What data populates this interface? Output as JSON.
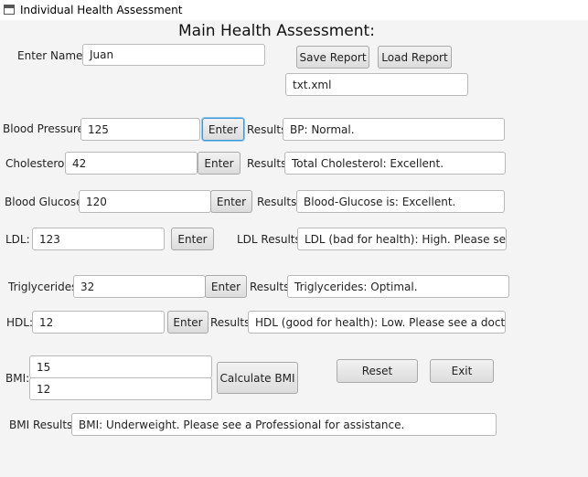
{
  "window": {
    "title": "Individual Health Assessment",
    "heading": "Main Health Assessment:"
  },
  "name": {
    "label": "Enter Name:",
    "value": "Juan"
  },
  "report": {
    "save_label": "Save Report",
    "load_label": "Load Report",
    "file_value": "txt.xml"
  },
  "blood_pressure": {
    "label": "Blood Pressure:",
    "value": "125",
    "enter_label": "Enter",
    "results_label": "Results:",
    "result": "BP: Normal."
  },
  "cholesterol": {
    "label": "Cholesterol:",
    "value": "42",
    "enter_label": "Enter",
    "results_label": "Results:",
    "result": "Total Cholesterol: Excellent."
  },
  "blood_glucose": {
    "label": "Blood Glucose:",
    "value": "120",
    "enter_label": "Enter",
    "results_label": "Results:",
    "result": "Blood-Glucose is: Excellent."
  },
  "ldl": {
    "label": "LDL:",
    "value": "123",
    "enter_label": "Enter",
    "results_label": "LDL Results:",
    "result": "LDL (bad for health): High. Please see a c"
  },
  "triglycerides": {
    "label": "Triglycerides:",
    "value": "32",
    "enter_label": "Enter",
    "results_label": "Results:",
    "result": "Triglycerides: Optimal."
  },
  "hdl": {
    "label": "HDL:",
    "value": "12",
    "enter_label": "Enter",
    "results_label": "Results:",
    "result": "HDL (good for health): Low. Please see a doctor."
  },
  "bmi": {
    "label": "BMI:",
    "value1": "15",
    "value2": "12",
    "calculate_label": "Calculate BMI",
    "results_label": "BMI Results:",
    "result": "BMI: Underweight. Please see a Professional for assistance."
  },
  "actions": {
    "reset_label": "Reset",
    "exit_label": "Exit"
  }
}
